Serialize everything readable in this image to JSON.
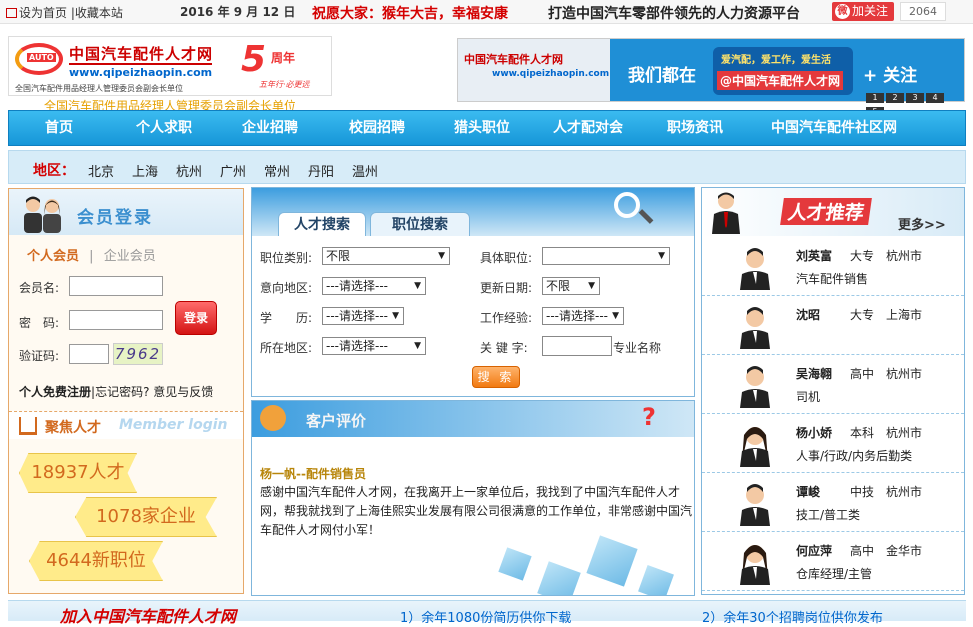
{
  "topbar": {
    "set_home": "设为首页",
    "separator": "|",
    "bookmark": "收藏本站",
    "date": "2016 年 9 月 12 日",
    "greeting": "祝愿大家：猴年大吉，幸福安康",
    "slogan": "打造中国汽车零部件领先的人力资源平台",
    "weibo_follow": "加关注",
    "weibo_icon": "weibo-icon",
    "weibo_count": "2064"
  },
  "header": {
    "logo_cn": "中国汽车配件人才网",
    "logo_url": "www.qipeizhaopin.com",
    "logo_sub": "全国汽车配件用品经理人管理委员会副会长单位",
    "logo_badge": "AUTO",
    "anniv_num": "5",
    "anniv_text": "周年",
    "anniv_sub": "五年行·必更远",
    "unit_line": "全国汽车配件用品经理人管理委员会副会长单位",
    "banner_logo": "中国汽车配件人才网",
    "banner_url": "www.qipeizhaopin.com",
    "banner_here": "我们都在",
    "banner_bubble_top": "爱汽配，爱工作，爱生活",
    "banner_bubble_handle": "@中国汽车配件人才网",
    "banner_follow": "+ 关注",
    "banner_pages": [
      "1",
      "2",
      "3",
      "4",
      "5"
    ]
  },
  "nav": {
    "items": [
      "首页",
      "个人求职",
      "企业招聘",
      "校园招聘",
      "猎头职位",
      "人才配对会",
      "职场资讯",
      "中国汽车配件社区网"
    ]
  },
  "region": {
    "label": "地区：",
    "cities": [
      "北京",
      "上海",
      "杭州",
      "广州",
      "常州",
      "丹阳",
      "温州"
    ]
  },
  "login": {
    "title": "会员登录",
    "tab_personal": "个人会员",
    "tab_sep": "|",
    "tab_company": "企业会员",
    "username_label": "会员名:",
    "password_label": "密　码:",
    "captcha_label": "验证码:",
    "captcha_text": "7962",
    "login_button": "登录",
    "register": "个人免费注册",
    "forgot": "忘记密码?",
    "feedback": "意见与反馈",
    "focus_title": "聚焦人才",
    "focus_en": "Member login",
    "stat_talent": "18937人才",
    "stat_company": "1078家企业",
    "stat_jobs": "4644新职位"
  },
  "search": {
    "tab_talent": "人才搜索",
    "tab_job": "职位搜索",
    "category_label": "职位类别:",
    "category_value": "不限",
    "position_label": "具体职位:",
    "position_value": "",
    "intent_label": "意向地区:",
    "intent_value": "---请选择---",
    "update_label": "更新日期:",
    "update_value": "不限",
    "edu_label": "学　　历:",
    "edu_value": "---请选择---",
    "exp_label": "工作经验:",
    "exp_value": "---请选择---",
    "location_label": "所在地区:",
    "location_value": "---请选择---",
    "keyword_label": "关 键 字:",
    "keyword_hint": "专业名称",
    "search_button": "搜 索"
  },
  "review": {
    "title": "客户评价",
    "name": "杨一帆--配件销售员",
    "body": "感谢中国汽车配件人才网，在我离开上一家单位后，我找到了中国汽车配件人才网，帮我就找到了上海佳熙实业发展有限公司很满意的工作单位，非常感谢中国汽车配件人才网付小军！"
  },
  "talent": {
    "title": "人才推荐",
    "more": "更多>>",
    "people": [
      {
        "name": "刘英富",
        "edu": "大专",
        "city": "杭州市",
        "job": "汽车配件销售",
        "gender": "male"
      },
      {
        "name": "沈昭",
        "edu": "大专",
        "city": "上海市",
        "job": "",
        "gender": "male"
      },
      {
        "name": "吴海翱",
        "edu": "高中",
        "city": "杭州市",
        "job": "司机",
        "gender": "male"
      },
      {
        "name": "杨小娇",
        "edu": "本科",
        "city": "杭州市",
        "job": "人事/行政/内务后勤类",
        "gender": "female"
      },
      {
        "name": "谭峻",
        "edu": "中技",
        "city": "杭州市",
        "job": "技工/普工类",
        "gender": "male"
      },
      {
        "name": "何应萍",
        "edu": "高中",
        "city": "金华市",
        "job": "仓库经理/主管",
        "gender": "female"
      }
    ]
  },
  "bottom": {
    "title": "加入中国汽车配件人才网",
    "item1": "1）余年1080份简历供你下载",
    "item2": "2）余年30个招聘岗位供你发布"
  },
  "colors": {
    "nav_blue": "#1696d8",
    "accent_red": "#d40000",
    "stat_orange": "#d2691e"
  }
}
